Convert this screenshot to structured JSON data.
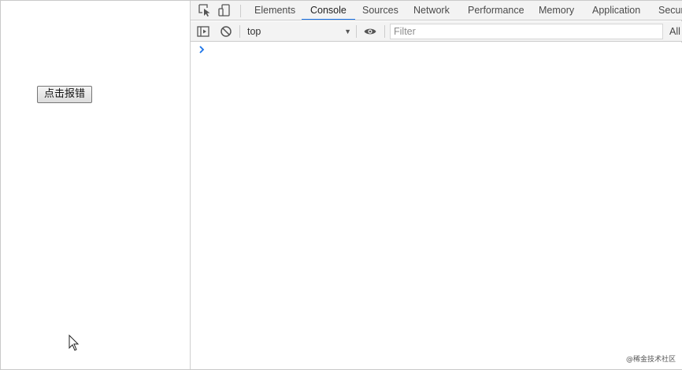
{
  "page": {
    "button_label": "点击报错"
  },
  "devtools": {
    "tabs": [
      {
        "label": "Elements"
      },
      {
        "label": "Console",
        "active": true
      },
      {
        "label": "Sources"
      },
      {
        "label": "Network"
      },
      {
        "label": "Performance"
      },
      {
        "label": "Memory"
      },
      {
        "label": "Application"
      },
      {
        "label": "Secur"
      }
    ],
    "icons": {
      "inspect": "inspect-element-icon",
      "device": "device-toolbar-icon",
      "sidebar": "show-sidebar-icon",
      "clear": "clear-console-icon",
      "eye": "live-expression-eye-icon",
      "prompt": "console-prompt-chevron-icon"
    },
    "console": {
      "context": "top",
      "filter_placeholder": "Filter",
      "levels": "All"
    },
    "accent": "#1a73e8"
  },
  "watermark": "@稀金技术社区"
}
